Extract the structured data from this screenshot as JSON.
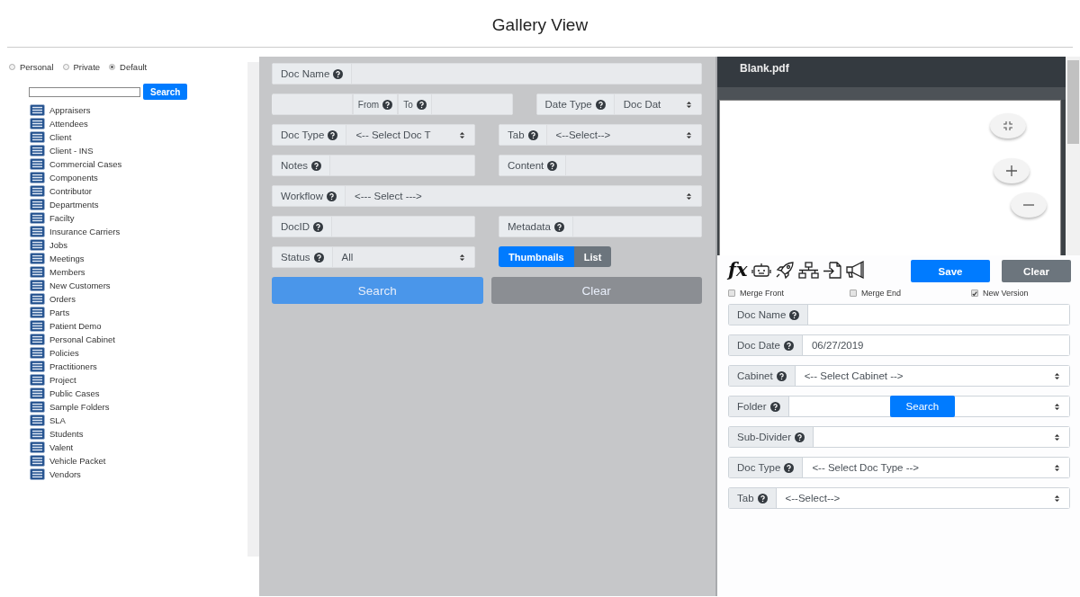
{
  "title": "Gallery View",
  "scope_options": [
    {
      "label": "Personal",
      "selected": false
    },
    {
      "label": "Private",
      "selected": false
    },
    {
      "label": "Default",
      "selected": true
    }
  ],
  "sidebar": {
    "search_button": "Search",
    "items": [
      "Appraisers",
      "Attendees",
      "Client",
      "Client - INS",
      "Commercial Cases",
      "Components",
      "Contributor",
      "Departments",
      "Facilty",
      "Insurance Carriers",
      "Jobs",
      "Meetings",
      "Members",
      "New Customers",
      "Orders",
      "Parts",
      "Patient Demo",
      "Personal Cabinet",
      "Policies",
      "Practitioners",
      "Project",
      "Public Cases",
      "Sample Folders",
      "SLA",
      "Students",
      "Valent",
      "Vehicle Packet",
      "Vendors"
    ]
  },
  "search_form": {
    "rows": [
      [
        {
          "kind": "input",
          "label": "Doc Name"
        }
      ],
      [
        {
          "kind": "range",
          "from": "From",
          "to": "To"
        },
        {
          "kind": "select",
          "label": "Date Type",
          "value": "Doc Dat"
        }
      ],
      [
        {
          "kind": "select",
          "label": "Doc Type",
          "value": "<-- Select Doc T"
        },
        {
          "kind": "select",
          "label": "Tab",
          "value": "<--Select-->"
        }
      ],
      [
        {
          "kind": "input",
          "label": "Notes"
        },
        {
          "kind": "input",
          "label": "Content"
        }
      ],
      [
        {
          "kind": "select",
          "label": "Workflow",
          "value": "<--- Select --->"
        }
      ],
      [
        {
          "kind": "input",
          "label": "DocID"
        },
        {
          "kind": "input",
          "label": "Metadata"
        }
      ],
      [
        {
          "kind": "select",
          "label": "Status",
          "value": "All"
        },
        {
          "kind": "toggle",
          "options": [
            {
              "label": "Thumbnails",
              "selected": true
            },
            {
              "label": "List",
              "selected": false
            }
          ]
        }
      ]
    ],
    "search_button": "Search",
    "clear_button": "Clear"
  },
  "viewer": {
    "file_name": "Blank.pdf"
  },
  "index_panel": {
    "fx": "fx",
    "save_button": "Save",
    "clear_button": "Clear",
    "options": [
      {
        "label": "Merge Front",
        "checked": false
      },
      {
        "label": "Merge End",
        "checked": false
      },
      {
        "label": "New Version",
        "checked": true
      }
    ],
    "fields": [
      {
        "kind": "input",
        "label": "Doc Name"
      },
      {
        "kind": "input",
        "label": "Doc Date",
        "value": "06/27/2019"
      },
      {
        "kind": "select",
        "label": "Cabinet",
        "value": "<-- Select Cabinet -->"
      },
      {
        "kind": "folder",
        "label": "Folder",
        "button": "Search"
      },
      {
        "kind": "select",
        "label": "Sub-Divider"
      },
      {
        "kind": "select",
        "label": "Doc Type",
        "value": "<-- Select Doc Type -->"
      },
      {
        "kind": "select",
        "label": "Tab",
        "value": "<--Select-->"
      }
    ]
  }
}
